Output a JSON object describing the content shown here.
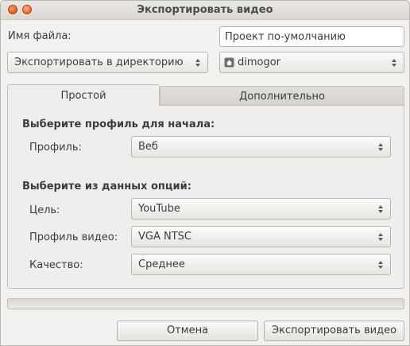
{
  "window": {
    "title": "Экспортировать видео"
  },
  "filename": {
    "label": "Имя файла:",
    "value": "Проект по-умолчанию"
  },
  "export_mode": {
    "selected": "Экспортировать в директорию"
  },
  "directory": {
    "selected": "dimogor",
    "icon": "home-folder-icon"
  },
  "tabs": [
    {
      "label": "Простой",
      "active": true
    },
    {
      "label": "Дополнительно",
      "active": false
    }
  ],
  "simple": {
    "start_section": "Выберите профиль для начала:",
    "profile": {
      "label": "Профиль:",
      "selected": "Веб"
    },
    "options_section": "Выберите из данных опций:",
    "target": {
      "label": "Цель:",
      "selected": "YouTube"
    },
    "video_profile": {
      "label": "Профиль видео:",
      "selected": "VGA NTSC"
    },
    "quality": {
      "label": "Качество:",
      "selected": "Среднее"
    }
  },
  "progress": {
    "fraction": 0
  },
  "buttons": {
    "cancel": "Отмена",
    "export": "Экспортировать видео"
  },
  "colors": {
    "accent": "#f07746",
    "close": "#e2571d"
  }
}
